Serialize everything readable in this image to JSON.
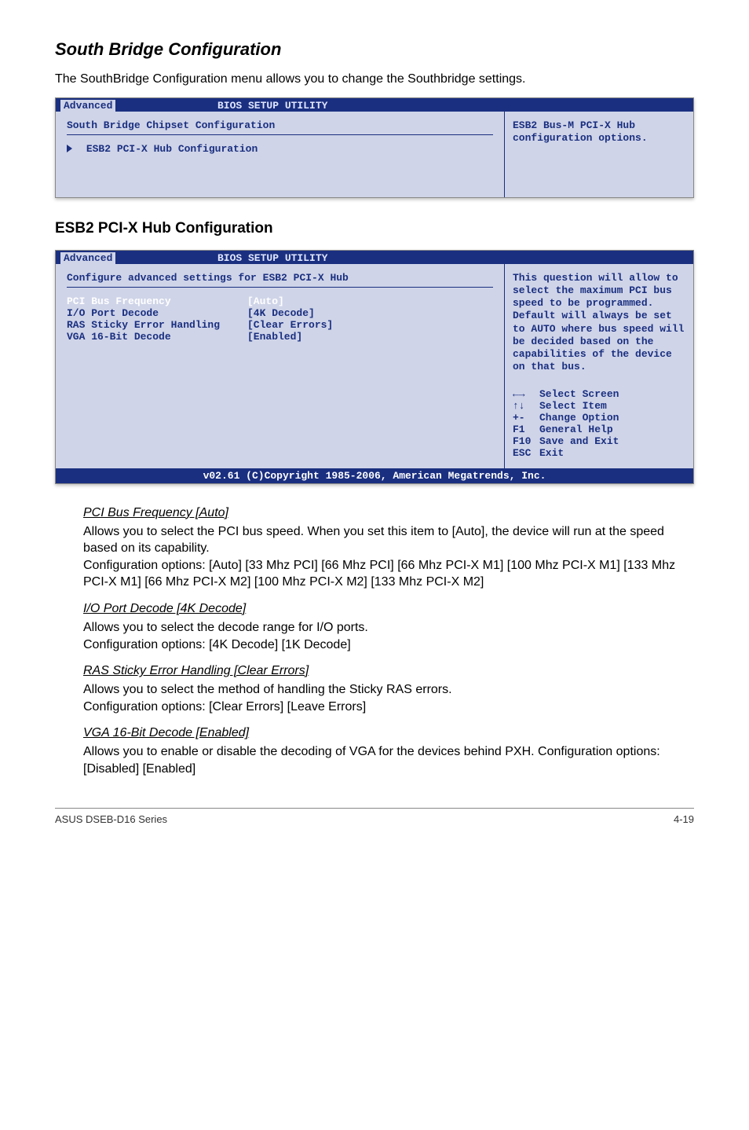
{
  "section": {
    "title": "South Bridge Configuration",
    "intro": "The SouthBridge Configuration menu allows you to change the Southbridge settings."
  },
  "bios1": {
    "title": "BIOS SETUP UTILITY",
    "tab": "Advanced",
    "header": "South Bridge Chipset Configuration",
    "submenu": "ESB2 PCI-X Hub Configuration",
    "help": "ESB2 Bus-M PCI-X Hub configuration options."
  },
  "subsection_title": "ESB2 PCI-X Hub Configuration",
  "bios2": {
    "title": "BIOS SETUP UTILITY",
    "tab": "Advanced",
    "header": "Configure advanced settings for ESB2 PCI-X Hub",
    "rows": {
      "r0": {
        "label": "PCI Bus Frequency",
        "value": "[Auto]"
      },
      "r1": {
        "label": "I/O Port Decode",
        "value": "[4K Decode]"
      },
      "r2": {
        "label": "RAS Sticky Error Handling",
        "value": "[Clear Errors]"
      },
      "r3": {
        "label": "VGA 16-Bit Decode",
        "value": "[Enabled]"
      }
    },
    "help": "This question will allow to select the maximum PCI bus speed to be programmed. Default will always be set to AUTO where bus speed will be decided based on the capabilities of the device on that bus.",
    "keys": {
      "k0": {
        "k": "←→",
        "d": "Select Screen"
      },
      "k1": {
        "k": "↑↓",
        "d": "Select Item"
      },
      "k2": {
        "k": "+-",
        "d": "Change Option"
      },
      "k3": {
        "k": "F1",
        "d": "General Help"
      },
      "k4": {
        "k": "F10",
        "d": "Save and Exit"
      },
      "k5": {
        "k": "ESC",
        "d": "Exit"
      }
    },
    "footer": "v02.61 (C)Copyright 1985-2006, American Megatrends, Inc."
  },
  "items": {
    "pci": {
      "title": "PCI Bus Frequency [Auto]",
      "body": "Allows you to select the PCI bus speed. When you set this item to [Auto], the device will run at the speed based on its capability.\nConfiguration options: [Auto] [33 Mhz PCI] [66 Mhz PCI] [66 Mhz PCI-X M1] [100 Mhz PCI-X M1] [133 Mhz PCI-X M1] [66 Mhz PCI-X M2] [100 Mhz PCI-X M2] [133 Mhz PCI-X M2]"
    },
    "io": {
      "title": "I/O Port Decode [4K Decode]",
      "body": "Allows you to select the decode range for I/O ports.\nConfiguration options: [4K Decode] [1K Decode]"
    },
    "ras": {
      "title": "RAS Sticky Error Handling [Clear Errors]",
      "body": "Allows you to select the method of handling the Sticky RAS errors.\nConfiguration options: [Clear Errors] [Leave Errors]"
    },
    "vga": {
      "title": "VGA 16-Bit Decode [Enabled]",
      "body": "Allows you to enable or disable the decoding of VGA for the devices behind PXH. Configuration options: [Disabled] [Enabled]"
    }
  },
  "footer": {
    "left": "ASUS DSEB-D16 Series",
    "right": "4-19"
  }
}
